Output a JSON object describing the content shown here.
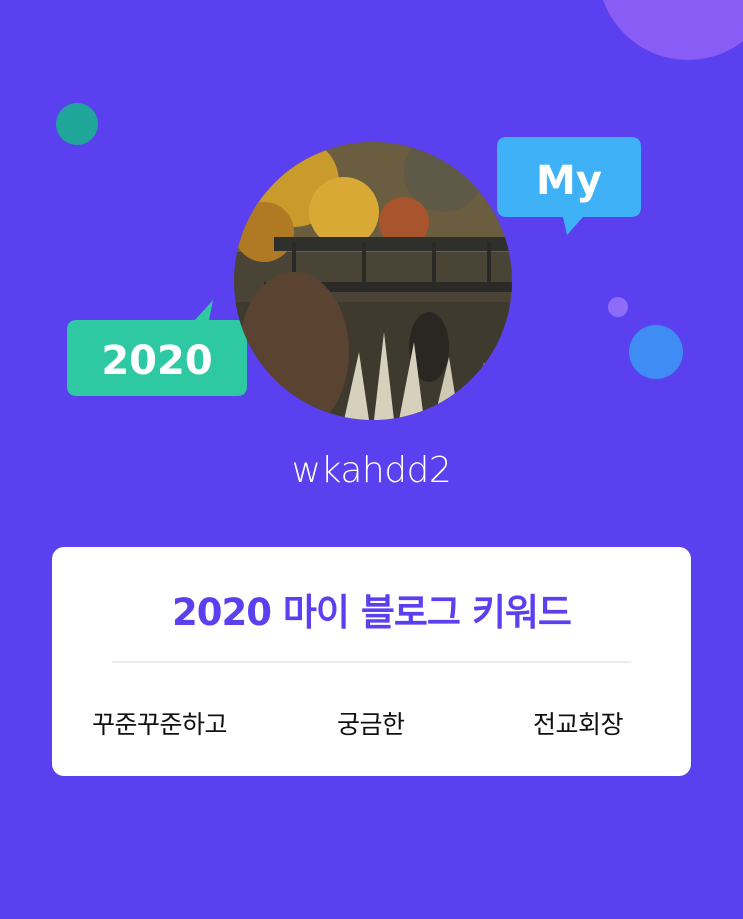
{
  "profile": {
    "username": "wkahdd2",
    "avatar": "profile-photo"
  },
  "badges": {
    "my_label": "My",
    "year_label": "2020"
  },
  "card": {
    "title": "2020 마이 블로그 키워드",
    "keywords": [
      "꾸준꾸준하고",
      "궁금한",
      "전교회장"
    ]
  },
  "colors": {
    "background": "#5b40f0",
    "accent_text": "#5b40f0",
    "my_bubble": "#3fb2f7",
    "year_bubble": "#2ec9a3"
  }
}
